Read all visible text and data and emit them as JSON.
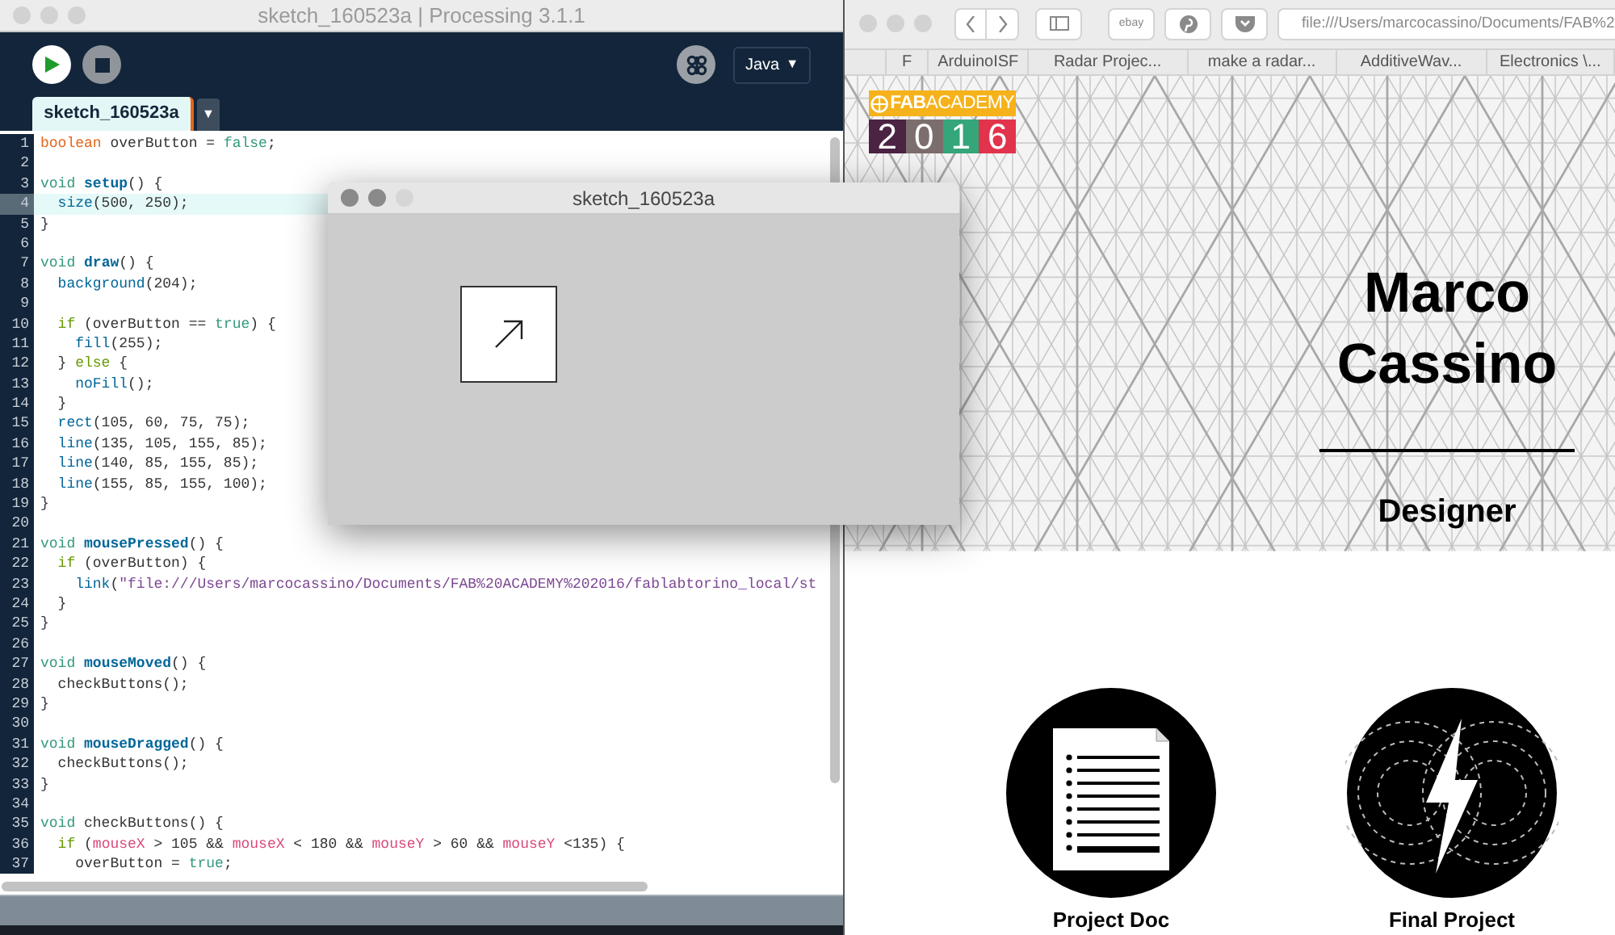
{
  "editor_window": {
    "title": "sketch_160523a | Processing 3.1.1",
    "mode": {
      "label": "Java",
      "caret": "▼"
    },
    "tab": {
      "label": "sketch_160523a",
      "selected": true
    },
    "tab_menu": "▼",
    "lines": [
      {
        "number": "1",
        "current": false,
        "tokens": [
          {
            "kind": "type",
            "text": "boolean"
          },
          {
            "kind": "plain",
            "text": " overButton = "
          },
          {
            "kind": "literal",
            "text": "false"
          },
          {
            "kind": "plain",
            "text": ";"
          }
        ]
      },
      {
        "number": "2",
        "current": false
      },
      {
        "number": "3",
        "current": false,
        "tokens": [
          {
            "kind": "keyword",
            "text": "void "
          },
          {
            "kind": "func",
            "text": "setup"
          },
          {
            "kind": "plain",
            "text": "() {"
          }
        ]
      },
      {
        "number": "4",
        "current": true,
        "tokens": [
          {
            "kind": "builtin",
            "text": "  size"
          },
          {
            "kind": "plain",
            "text": "(500, 250);"
          }
        ]
      },
      {
        "number": "5",
        "current": false,
        "tokens": [
          {
            "kind": "plain",
            "text": "}"
          }
        ]
      },
      {
        "number": "6",
        "current": false
      },
      {
        "number": "7",
        "current": false,
        "tokens": [
          {
            "kind": "keyword",
            "text": "void "
          },
          {
            "kind": "func",
            "text": "draw"
          },
          {
            "kind": "plain",
            "text": "() {"
          }
        ]
      },
      {
        "number": "8",
        "current": false,
        "tokens": [
          {
            "kind": "builtin",
            "text": "  background"
          },
          {
            "kind": "plain",
            "text": "(204);"
          }
        ]
      },
      {
        "number": "9",
        "current": false
      },
      {
        "number": "10",
        "current": false,
        "tokens": [
          {
            "kind": "control",
            "text": "  if"
          },
          {
            "kind": "plain",
            "text": " (overButton == "
          },
          {
            "kind": "literal",
            "text": "true"
          },
          {
            "kind": "plain",
            "text": ") {"
          }
        ]
      },
      {
        "number": "11",
        "current": false,
        "tokens": [
          {
            "kind": "builtin",
            "text": "    fill"
          },
          {
            "kind": "plain",
            "text": "(255);"
          }
        ]
      },
      {
        "number": "12",
        "current": false,
        "tokens": [
          {
            "kind": "plain",
            "text": "  } "
          },
          {
            "kind": "control",
            "text": "else"
          },
          {
            "kind": "plain",
            "text": " {"
          }
        ]
      },
      {
        "number": "13",
        "current": false,
        "tokens": [
          {
            "kind": "builtin",
            "text": "    noFill"
          },
          {
            "kind": "plain",
            "text": "();"
          }
        ]
      },
      {
        "number": "14",
        "current": false,
        "tokens": [
          {
            "kind": "plain",
            "text": "  }"
          }
        ]
      },
      {
        "number": "15",
        "current": false,
        "tokens": [
          {
            "kind": "builtin",
            "text": "  rect"
          },
          {
            "kind": "plain",
            "text": "(105, 60, 75, 75);"
          }
        ]
      },
      {
        "number": "16",
        "current": false,
        "tokens": [
          {
            "kind": "builtin",
            "text": "  line"
          },
          {
            "kind": "plain",
            "text": "(135, 105, 155, 85);"
          }
        ]
      },
      {
        "number": "17",
        "current": false,
        "tokens": [
          {
            "kind": "builtin",
            "text": "  line"
          },
          {
            "kind": "plain",
            "text": "(140, 85, 155, 85);"
          }
        ]
      },
      {
        "number": "18",
        "current": false,
        "tokens": [
          {
            "kind": "builtin",
            "text": "  line"
          },
          {
            "kind": "plain",
            "text": "(155, 85, 155, 100);"
          }
        ]
      },
      {
        "number": "19",
        "current": false,
        "tokens": [
          {
            "kind": "plain",
            "text": "}"
          }
        ]
      },
      {
        "number": "20",
        "current": false
      },
      {
        "number": "21",
        "current": false,
        "tokens": [
          {
            "kind": "keyword",
            "text": "void "
          },
          {
            "kind": "func",
            "text": "mousePressed"
          },
          {
            "kind": "plain",
            "text": "() {"
          }
        ]
      },
      {
        "number": "22",
        "current": false,
        "tokens": [
          {
            "kind": "control",
            "text": "  if"
          },
          {
            "kind": "plain",
            "text": " (overButton) {"
          }
        ]
      },
      {
        "number": "23",
        "current": false,
        "tokens": [
          {
            "kind": "builtin",
            "text": "    link"
          },
          {
            "kind": "plain",
            "text": "("
          },
          {
            "kind": "string",
            "text": "\"file:///Users/marcocassino/Documents/FAB%20ACADEMY%202016/fablabtorino_local/st"
          }
        ]
      },
      {
        "number": "24",
        "current": false,
        "tokens": [
          {
            "kind": "plain",
            "text": "  }"
          }
        ]
      },
      {
        "number": "25",
        "current": false,
        "tokens": [
          {
            "kind": "plain",
            "text": "}"
          }
        ]
      },
      {
        "number": "26",
        "current": false
      },
      {
        "number": "27",
        "current": false,
        "tokens": [
          {
            "kind": "keyword",
            "text": "void "
          },
          {
            "kind": "func",
            "text": "mouseMoved"
          },
          {
            "kind": "plain",
            "text": "() {"
          }
        ]
      },
      {
        "number": "28",
        "current": false,
        "tokens": [
          {
            "kind": "plain",
            "text": "  checkButtons();"
          }
        ]
      },
      {
        "number": "29",
        "current": false,
        "tokens": [
          {
            "kind": "plain",
            "text": "}"
          }
        ]
      },
      {
        "number": "30",
        "current": false
      },
      {
        "number": "31",
        "current": false,
        "tokens": [
          {
            "kind": "keyword",
            "text": "void "
          },
          {
            "kind": "func",
            "text": "mouseDragged"
          },
          {
            "kind": "plain",
            "text": "() {"
          }
        ]
      },
      {
        "number": "32",
        "current": false,
        "tokens": [
          {
            "kind": "plain",
            "text": "  checkButtons();"
          }
        ]
      },
      {
        "number": "33",
        "current": false,
        "tokens": [
          {
            "kind": "plain",
            "text": "}"
          }
        ]
      },
      {
        "number": "34",
        "current": false
      },
      {
        "number": "35",
        "current": false,
        "tokens": [
          {
            "kind": "keyword",
            "text": "void"
          },
          {
            "kind": "plain",
            "text": " checkButtons() {"
          }
        ]
      },
      {
        "number": "36",
        "current": false,
        "tokens": [
          {
            "kind": "control",
            "text": "  if"
          },
          {
            "kind": "plain",
            "text": " ("
          },
          {
            "kind": "var",
            "text": "mouseX"
          },
          {
            "kind": "plain",
            "text": " > 105 && "
          },
          {
            "kind": "var",
            "text": "mouseX"
          },
          {
            "kind": "plain",
            "text": " < 180 && "
          },
          {
            "kind": "var",
            "text": "mouseY"
          },
          {
            "kind": "plain",
            "text": " > 60 && "
          },
          {
            "kind": "var",
            "text": "mouseY"
          },
          {
            "kind": "plain",
            "text": " <135) {"
          }
        ]
      },
      {
        "number": "37",
        "current": false,
        "tokens": [
          {
            "kind": "plain",
            "text": "    overButton = "
          },
          {
            "kind": "literal",
            "text": "true"
          },
          {
            "kind": "plain",
            "text": ";"
          }
        ]
      }
    ]
  },
  "sketch_window": {
    "title": "sketch_160523a"
  },
  "browser": {
    "ebay": "ebay",
    "url": "file:///Users/marcocassino/Documents/FAB%2",
    "bookmarks": [
      "F",
      "ArduinoISF",
      "Radar Projec...",
      "make a radar...",
      "AdditiveWav...",
      "Electronics \\..."
    ],
    "page": {
      "logo": {
        "text": "**FAB**ACADEMY",
        "digits": [
          {
            "text": "2",
            "color": "#4b2343"
          },
          {
            "text": "0",
            "color": "#7d6e6e"
          },
          {
            "text": "1",
            "color": "#35a57a"
          },
          {
            "text": "6",
            "color": "#e1344c"
          }
        ]
      },
      "name": "Marco Cassino",
      "role": "Designer",
      "cards": [
        {
          "label": "Project Doc",
          "kind": "document"
        },
        {
          "label": "Final Project",
          "kind": "lightning"
        }
      ]
    }
  }
}
